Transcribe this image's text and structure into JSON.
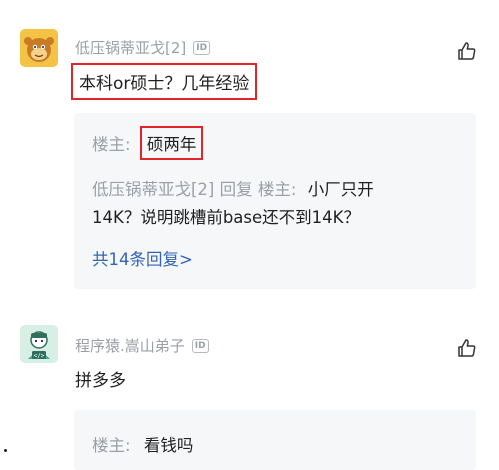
{
  "comments": [
    {
      "username": "低压锅蒂亚戈[2]",
      "id_badge": "ID",
      "avatar_icon": "monkey-avatar-icon",
      "like_icon": "thumbs-up-icon",
      "text": "本科or硕士？几年经验",
      "reply_panel": {
        "first_reply": {
          "author_label": "楼主:",
          "text": "硕两年"
        },
        "second_reply": {
          "author": "低压锅蒂亚戈[2]",
          "action": "回复",
          "target": "楼主:",
          "text_line1": "小厂只开",
          "text_line2": "14K？说明跳槽前base还不到14K？"
        },
        "more_replies_link": "共14条回复>"
      }
    },
    {
      "username": "程序猿.嵩山弟子",
      "id_badge": "ID",
      "avatar_icon": "programmer-avatar-icon",
      "like_icon": "thumbs-up-icon",
      "text": "拼多多",
      "reply_panel": {
        "first_reply": {
          "author_label": "楼主:",
          "text": "看钱吗"
        }
      }
    }
  ],
  "colors": {
    "highlight_border": "#e0262b",
    "link": "#3464b4",
    "muted_text": "#9aa0a8",
    "panel_bg": "#f6f7f9"
  }
}
